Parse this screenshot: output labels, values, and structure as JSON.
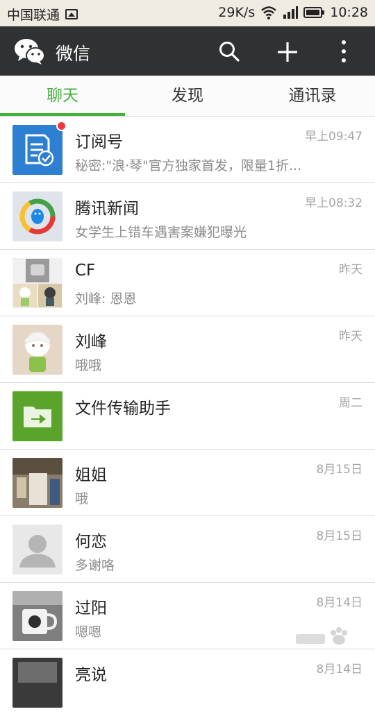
{
  "status_bar": {
    "carrier": "中国联通",
    "speed": "29K/s",
    "time": "10:28"
  },
  "header": {
    "title": "微信",
    "icons": [
      "wechat-logo",
      "search-icon",
      "plus-icon",
      "more-icon"
    ]
  },
  "tabs": [
    {
      "label": "聊天",
      "active": true
    },
    {
      "label": "发现",
      "active": false
    },
    {
      "label": "通讯录",
      "active": false
    }
  ],
  "chats": [
    {
      "name": "订阅号",
      "preview": "秘密:\"浪·琴\"官方独家首发，限量1折...",
      "time": "早上09:47",
      "unread": true
    },
    {
      "name": "腾讯新闻",
      "preview": "女学生上错车遇害案嫌犯曝光",
      "time": "早上08:32",
      "unread": false
    },
    {
      "name": "CF",
      "preview": "刘峰: 恩恩",
      "time": "昨天",
      "unread": false
    },
    {
      "name": "刘峰",
      "preview": "哦哦",
      "time": "昨天",
      "unread": false
    },
    {
      "name": "文件传输助手",
      "preview": "",
      "time": "周二",
      "unread": false
    },
    {
      "name": "姐姐",
      "preview": "哦",
      "time": "8月15日",
      "unread": false
    },
    {
      "name": "何恋",
      "preview": "多谢咯",
      "time": "8月15日",
      "unread": false
    },
    {
      "name": "过阳",
      "preview": "嗯嗯",
      "time": "8月14日",
      "unread": false
    },
    {
      "name": "亮说",
      "preview": "",
      "time": "8月14日",
      "unread": false
    }
  ],
  "colors": {
    "accent": "#45b13c",
    "header_bg": "#2f3132",
    "status_bg": "#efebe0"
  }
}
